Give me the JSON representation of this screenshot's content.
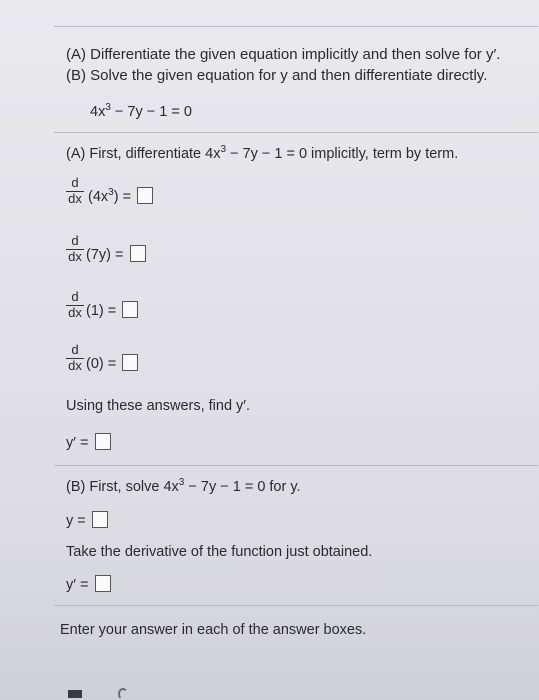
{
  "instructions": {
    "a": "(A) Differentiate the given equation implicitly and then solve for y′.",
    "b": "(B) Solve the given equation for y and then differentiate directly."
  },
  "equation": {
    "base": "4x",
    "exp": "3",
    "rest": " − 7y − 1 = 0"
  },
  "partA": {
    "heading_pre": "(A) First, differentiate 4x",
    "heading_exp": "3",
    "heading_post": " − 7y − 1 = 0 implicitly, term by term.",
    "d": "d",
    "dx": "dx",
    "terms": [
      {
        "label_pre": "(4x",
        "label_exp": "3",
        "label_post": ") ="
      },
      {
        "label": "(7y) ="
      },
      {
        "label": "(1) ="
      },
      {
        "label": "(0) ="
      }
    ],
    "using": "Using these answers, find y′.",
    "yprime": "y′ ="
  },
  "partB": {
    "heading_pre": "(B) First, solve 4x",
    "heading_exp": "3",
    "heading_post": " − 7y − 1 = 0 for y.",
    "y_label": "y =",
    "take": "Take the derivative of the function just obtained.",
    "yprime": "y′ ="
  },
  "footer": "Enter your answer in each of the answer boxes."
}
